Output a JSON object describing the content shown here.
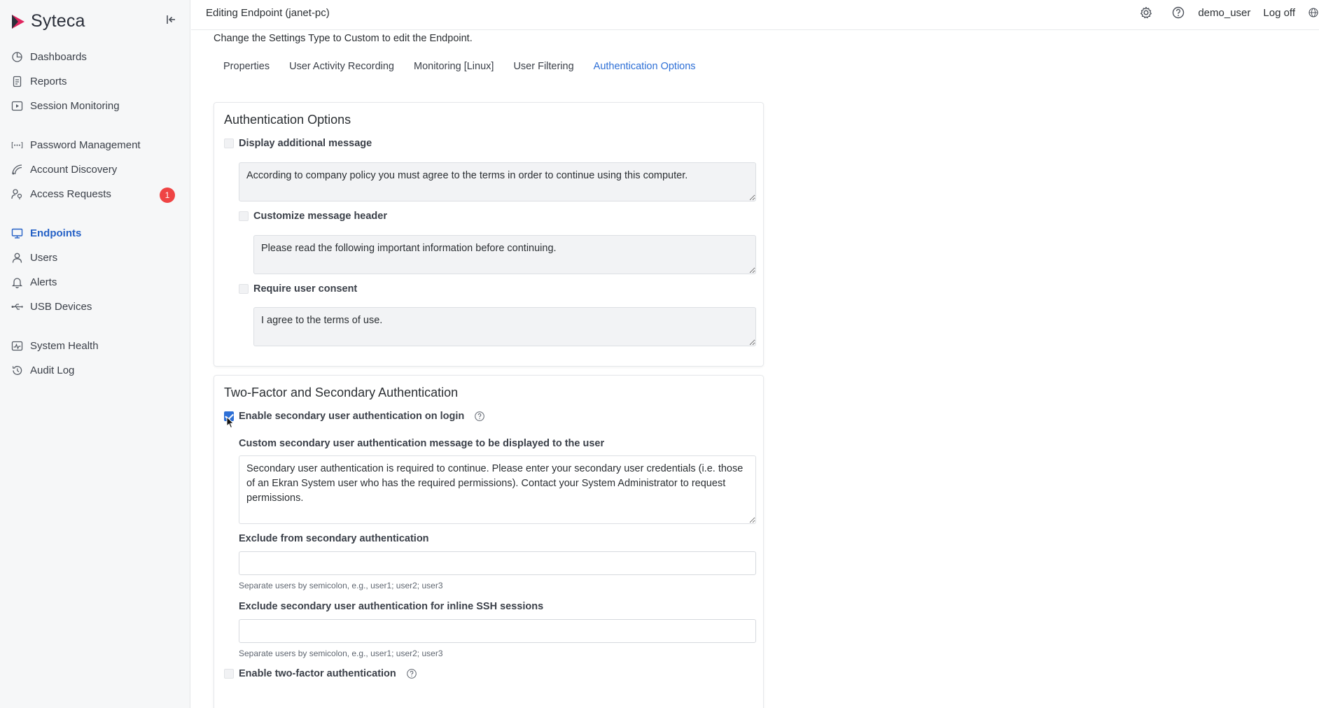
{
  "app": {
    "brand": "Syteca",
    "brand_color": "#e0245e"
  },
  "sidebar": {
    "groups": [
      {
        "items": [
          {
            "label": "Dashboards",
            "icon": "dashboard-icon"
          },
          {
            "label": "Reports",
            "icon": "document-icon"
          },
          {
            "label": "Session Monitoring",
            "icon": "play-screen-icon"
          }
        ]
      },
      {
        "items": [
          {
            "label": "Password Management",
            "icon": "password-dots-icon"
          },
          {
            "label": "Account Discovery",
            "icon": "radar-icon"
          },
          {
            "label": "Access Requests",
            "icon": "user-key-icon",
            "badge": "1"
          }
        ]
      },
      {
        "items": [
          {
            "label": "Endpoints",
            "icon": "monitor-icon",
            "active": true
          },
          {
            "label": "Users",
            "icon": "user-icon"
          },
          {
            "label": "Alerts",
            "icon": "bell-icon"
          },
          {
            "label": "USB Devices",
            "icon": "usb-icon"
          }
        ]
      },
      {
        "items": [
          {
            "label": "System Health",
            "icon": "health-chart-icon"
          },
          {
            "label": "Audit Log",
            "icon": "history-icon"
          }
        ]
      }
    ]
  },
  "topbar": {
    "title": "Editing Endpoint (janet-pc)",
    "user": "demo_user",
    "logoff": "Log off"
  },
  "main": {
    "hint": "Change the Settings Type to Custom to edit the Endpoint.",
    "tabs": [
      {
        "label": "Properties"
      },
      {
        "label": "User Activity Recording"
      },
      {
        "label": "Monitoring [Linux]"
      },
      {
        "label": "User Filtering"
      },
      {
        "label": "Authentication Options",
        "active": true
      }
    ],
    "auth_options": {
      "title": "Authentication Options",
      "display_message_label": "Display additional message",
      "display_message_value": "According to company policy you must agree to the terms in order to continue using this computer.",
      "customize_header_label": "Customize message header",
      "customize_header_value": "Please read the following important information before continuing.",
      "require_consent_label": "Require user consent",
      "require_consent_value": "I agree to the terms of use."
    },
    "two_factor": {
      "title": "Two-Factor and Secondary Authentication",
      "enable_secondary_label": "Enable secondary user authentication on login",
      "enable_secondary_checked": true,
      "custom_message_label": "Custom secondary user authentication message to be displayed to the user",
      "custom_message_value": "Secondary user authentication is required to continue. Please enter your secondary user credentials (i.e. those of an Ekran System user who has the required permissions). Contact your System Administrator to request permissions.",
      "exclude_label": "Exclude from secondary authentication",
      "exclude_value": "",
      "exclude_helper": "Separate users by semicolon, e.g., user1; user2; user3",
      "exclude_ssh_label": "Exclude secondary user authentication for inline SSH sessions",
      "exclude_ssh_value": "",
      "exclude_ssh_helper": "Separate users by semicolon, e.g., user1; user2; user3",
      "enable_2fa_label": "Enable two-factor authentication",
      "enable_2fa_checked": false
    }
  }
}
